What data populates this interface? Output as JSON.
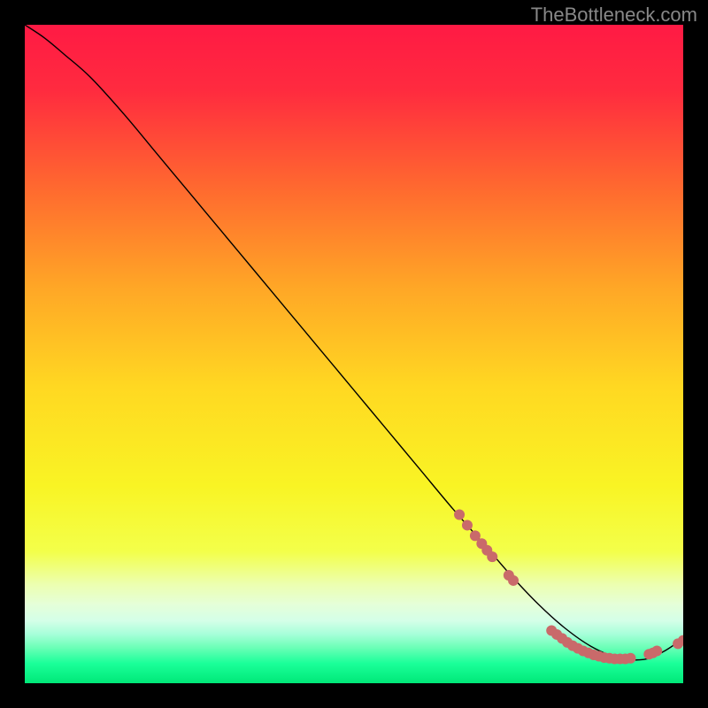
{
  "watermark": "TheBottleneck.com",
  "chart_data": {
    "type": "line",
    "title": "",
    "xlabel": "",
    "ylabel": "",
    "xlim": [
      0,
      100
    ],
    "ylim": [
      0,
      100
    ],
    "grid": false,
    "legend": false,
    "background_gradient": {
      "type": "vertical",
      "stops": [
        {
          "pos": 0.0,
          "color": "#ff1a44"
        },
        {
          "pos": 0.1,
          "color": "#ff2b3f"
        },
        {
          "pos": 0.25,
          "color": "#ff6a2f"
        },
        {
          "pos": 0.4,
          "color": "#ffa726"
        },
        {
          "pos": 0.55,
          "color": "#ffd822"
        },
        {
          "pos": 0.7,
          "color": "#f9f424"
        },
        {
          "pos": 0.8,
          "color": "#f3ff4a"
        },
        {
          "pos": 0.85,
          "color": "#ecffb0"
        },
        {
          "pos": 0.88,
          "color": "#e5ffd8"
        },
        {
          "pos": 0.905,
          "color": "#d4ffe8"
        },
        {
          "pos": 0.925,
          "color": "#a8ffda"
        },
        {
          "pos": 0.945,
          "color": "#6effb8"
        },
        {
          "pos": 0.97,
          "color": "#1aff99"
        },
        {
          "pos": 1.0,
          "color": "#00e878"
        }
      ]
    },
    "series": [
      {
        "name": "bottleneck-curve",
        "color": "#000000",
        "stroke_width": 1.4,
        "x": [
          0,
          3,
          6,
          10,
          15,
          20,
          25,
          30,
          35,
          40,
          45,
          50,
          55,
          60,
          65,
          70,
          74,
          78,
          82,
          86,
          90,
          94,
          97,
          100
        ],
        "y": [
          100,
          98,
          95.5,
          92,
          86.5,
          80.5,
          74.5,
          68.5,
          62.5,
          56.5,
          50.5,
          44.5,
          38.5,
          32.5,
          26.5,
          20.8,
          16.2,
          12.0,
          8.4,
          5.6,
          3.9,
          3.6,
          4.8,
          6.8
        ]
      }
    ],
    "markers": [
      {
        "name": "cluster-points",
        "color": "#c96a6a",
        "radius": 6,
        "points": [
          {
            "x": 66.0,
            "y": 25.6
          },
          {
            "x": 67.2,
            "y": 24.0
          },
          {
            "x": 68.4,
            "y": 22.4
          },
          {
            "x": 69.4,
            "y": 21.2
          },
          {
            "x": 70.2,
            "y": 20.2
          },
          {
            "x": 71.0,
            "y": 19.2
          },
          {
            "x": 73.5,
            "y": 16.4
          },
          {
            "x": 74.2,
            "y": 15.6
          },
          {
            "x": 80.0,
            "y": 8.0
          },
          {
            "x": 80.8,
            "y": 7.4
          },
          {
            "x": 81.6,
            "y": 6.8
          },
          {
            "x": 82.4,
            "y": 6.2
          },
          {
            "x": 83.2,
            "y": 5.7
          },
          {
            "x": 84.0,
            "y": 5.3
          },
          {
            "x": 84.8,
            "y": 4.9
          },
          {
            "x": 85.6,
            "y": 4.6
          },
          {
            "x": 86.4,
            "y": 4.3
          },
          {
            "x": 87.2,
            "y": 4.1
          },
          {
            "x": 88.0,
            "y": 3.9
          },
          {
            "x": 88.8,
            "y": 3.8
          },
          {
            "x": 89.6,
            "y": 3.7
          },
          {
            "x": 90.4,
            "y": 3.7
          },
          {
            "x": 91.2,
            "y": 3.7
          },
          {
            "x": 92.0,
            "y": 3.8
          },
          {
            "x": 94.8,
            "y": 4.4
          },
          {
            "x": 95.4,
            "y": 4.6
          },
          {
            "x": 96.0,
            "y": 4.9
          },
          {
            "x": 99.2,
            "y": 6.0
          },
          {
            "x": 100.0,
            "y": 6.5
          }
        ]
      }
    ]
  }
}
